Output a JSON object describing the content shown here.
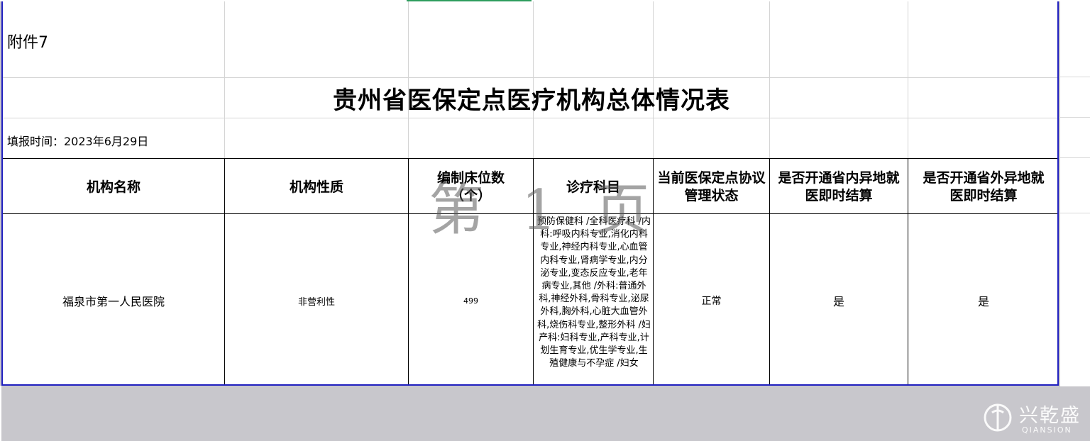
{
  "attachment_label": "附件7",
  "title": "贵州省医保定点医疗机构总体情况表",
  "fill_date": "填报时间：2023年6月29日",
  "table": {
    "headers": {
      "name": "机构名称",
      "nature": "机构性质",
      "beds": "编制床位数（个）",
      "depts": "诊疗科目",
      "status": "当前医保定点协议管理状态",
      "in_province": "是否开通省内异地就医即时结算",
      "out_province": "是否开通省外异地就医即时结算"
    },
    "row": {
      "name": "福泉市第一人民医院",
      "nature": "非营利性",
      "beds": "499",
      "depts": "预防保健科 /全科医疗科 /内科:呼吸内科专业,消化内科专业,神经内科专业,心血管内科专业,肾病学专业,内分泌专业,变态反应专业,老年病专业,其他 /外科:普通外科,神经外科,骨科专业,泌尿外科,胸外科,心脏大血管外科,烧伤科专业,整形外科 /妇产科:妇科专业,产科专业,计划生育专业,优生学专业,生殖健康与不孕症 /妇女",
      "status": "正常",
      "in_province": "是",
      "out_province": "是"
    }
  },
  "watermark": "第 1 页",
  "logo": {
    "cn": "兴乾盛",
    "en": "QIANSION"
  }
}
